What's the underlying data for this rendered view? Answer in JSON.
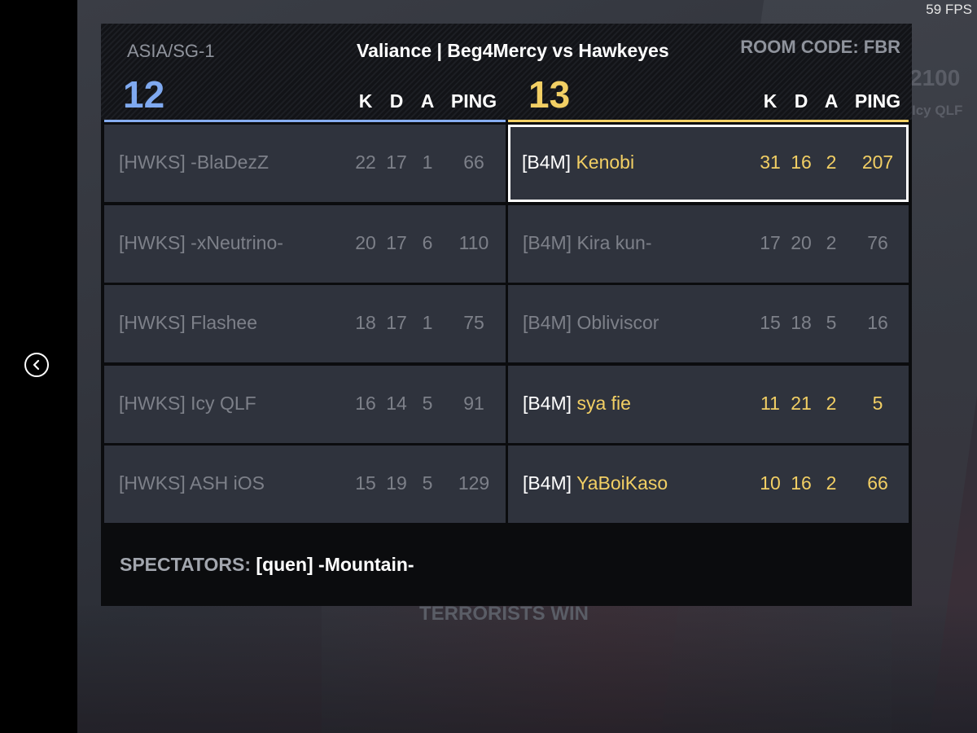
{
  "fps": "59 FPS",
  "region": "ASIA/SG-1",
  "match_title": "Valiance | Beg4Mercy vs Hawkeyes",
  "room_code": "ROOM CODE: FBR",
  "teams": {
    "left": {
      "score": "12",
      "color": "#7fa9f0",
      "headers": {
        "k": "K",
        "d": "D",
        "a": "A",
        "ping": "PING"
      },
      "players": [
        {
          "tag": "[HWKS]",
          "name": "-BlaDezZ",
          "k": "22",
          "d": "17",
          "a": "1",
          "ping": "66"
        },
        {
          "tag": "[HWKS]",
          "name": "-xNeutrino-",
          "k": "20",
          "d": "17",
          "a": "6",
          "ping": "110"
        },
        {
          "tag": "[HWKS]",
          "name": "Flashee",
          "k": "18",
          "d": "17",
          "a": "1",
          "ping": "75"
        },
        {
          "tag": "[HWKS]",
          "name": "Icy QLF",
          "k": "16",
          "d": "14",
          "a": "5",
          "ping": "91"
        },
        {
          "tag": "[HWKS]",
          "name": "ASH iOS",
          "k": "15",
          "d": "19",
          "a": "5",
          "ping": "129"
        }
      ]
    },
    "right": {
      "score": "13",
      "color": "#f2cf64",
      "headers": {
        "k": "K",
        "d": "D",
        "a": "A",
        "ping": "PING"
      },
      "players": [
        {
          "tag": "[B4M]",
          "name": "Kenobi",
          "k": "31",
          "d": "16",
          "a": "2",
          "ping": "207"
        },
        {
          "tag": "[B4M]",
          "name": "Kira kun-",
          "k": "17",
          "d": "20",
          "a": "2",
          "ping": "76"
        },
        {
          "tag": "[B4M]",
          "name": "Obliviscor",
          "k": "15",
          "d": "18",
          "a": "5",
          "ping": "16"
        },
        {
          "tag": "[B4M]",
          "name": "sya fie",
          "k": "11",
          "d": "21",
          "a": "2",
          "ping": "5"
        },
        {
          "tag": "[B4M]",
          "name": "YaBoiKaso",
          "k": "10",
          "d": "16",
          "a": "2",
          "ping": "66"
        }
      ]
    }
  },
  "spectators": {
    "label": "SPECTATORS:",
    "value": "[quen] -Mountain-"
  },
  "background": {
    "banner": "TERRORISTS WIN",
    "score_hint": "2100",
    "player_hint": "Icy QLF"
  },
  "icons": {
    "back": "chevron-left-circle-icon"
  }
}
